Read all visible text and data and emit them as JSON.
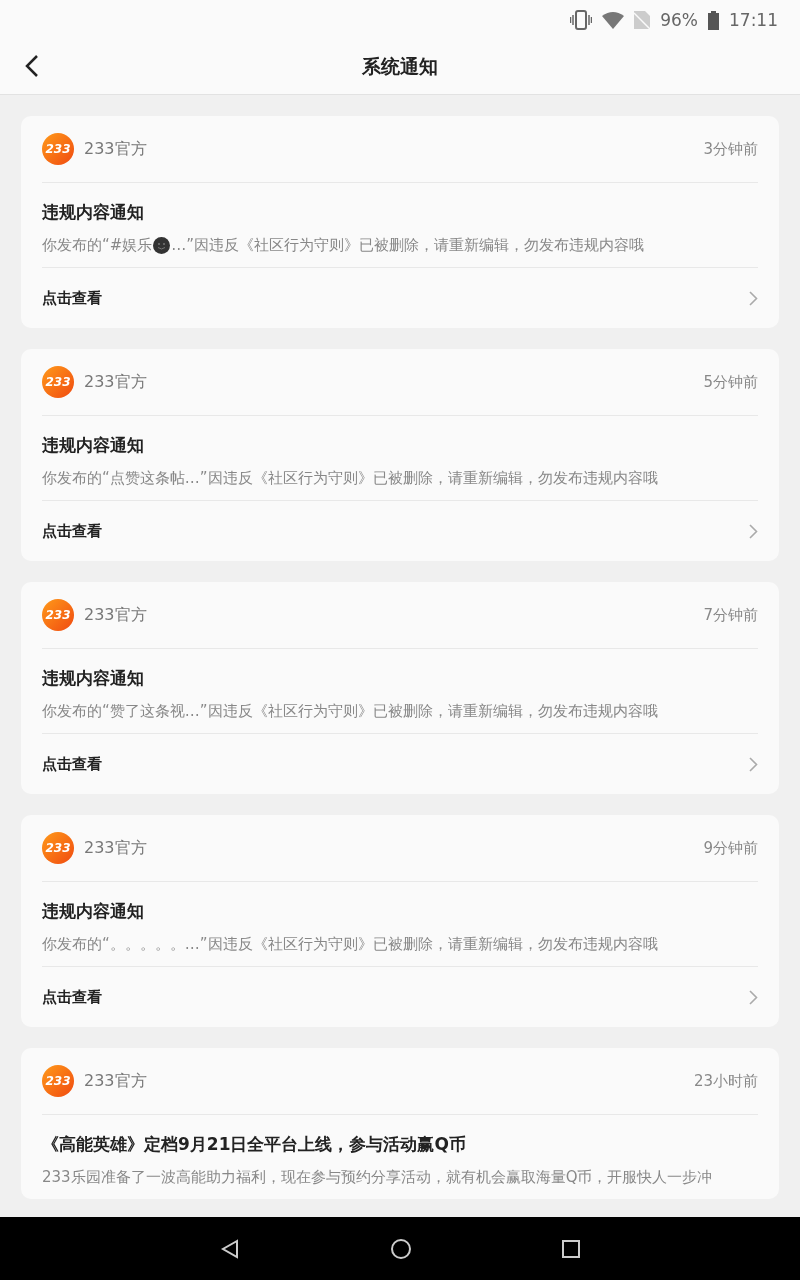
{
  "status_bar": {
    "battery": "96%",
    "time": "17:11"
  },
  "header": {
    "title": "系统通知"
  },
  "notices": [
    {
      "logo_text": "233",
      "sender": "233官方",
      "time": "3分钟前",
      "title": "违规内容通知",
      "body": "你发布的“#娱乐",
      "emoji": true,
      "body_after": "…”因违反《社区行为守则》已被删除，请重新编辑，勿发布违规内容哦",
      "action": "点击查看"
    },
    {
      "logo_text": "233",
      "sender": "233官方",
      "time": "5分钟前",
      "title": "违规内容通知",
      "body": "你发布的“点赞这条帖…”因违反《社区行为守则》已被删除，请重新编辑，勿发布违规内容哦",
      "action": "点击查看"
    },
    {
      "logo_text": "233",
      "sender": "233官方",
      "time": "7分钟前",
      "title": "违规内容通知",
      "body": "你发布的“赞了这条视…”因违反《社区行为守则》已被删除，请重新编辑，勿发布违规内容哦",
      "action": "点击查看"
    },
    {
      "logo_text": "233",
      "sender": "233官方",
      "time": "9分钟前",
      "title": "违规内容通知",
      "body": "你发布的“。。。。。…”因违反《社区行为守则》已被删除，请重新编辑，勿发布违规内容哦",
      "action": "点击查看"
    },
    {
      "logo_text": "233",
      "sender": "233官方",
      "time": "23小时前",
      "title": "《高能英雄》定档9月21日全平台上线，参与活动赢Q币",
      "body": "233乐园准备了一波高能助力福利，现在参与预约分享活动，就有机会赢取海量Q币，开服快人一步冲"
    }
  ]
}
